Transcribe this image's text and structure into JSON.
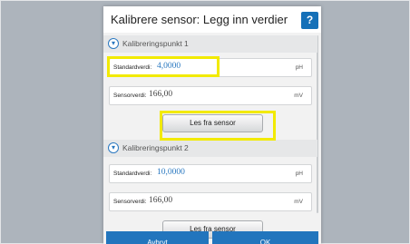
{
  "dialog": {
    "title": "Kalibrere sensor: Legg inn verdier",
    "help_label": "?"
  },
  "sections": [
    {
      "label": "Kalibreringspunkt 1",
      "standard_label": "Standardverdi:",
      "standard_value": "4,0000",
      "standard_unit": "pH",
      "sensor_label": "Sensorverdi:",
      "sensor_value": "166,00",
      "sensor_unit": "mV",
      "read_button": "Les fra sensor"
    },
    {
      "label": "Kalibreringspunkt 2",
      "standard_label": "Standardverdi:",
      "standard_value": "10,0000",
      "standard_unit": "pH",
      "sensor_label": "Sensorverdi:",
      "sensor_value": "166,00",
      "sensor_unit": "mV",
      "read_button": "Les fra sensor"
    }
  ],
  "footer": {
    "cancel_label": "Avbryt",
    "ok_label": "OK"
  },
  "colors": {
    "accent": "#2275bd",
    "highlight": "#f2ea00",
    "value_blue": "#2a78c0"
  }
}
